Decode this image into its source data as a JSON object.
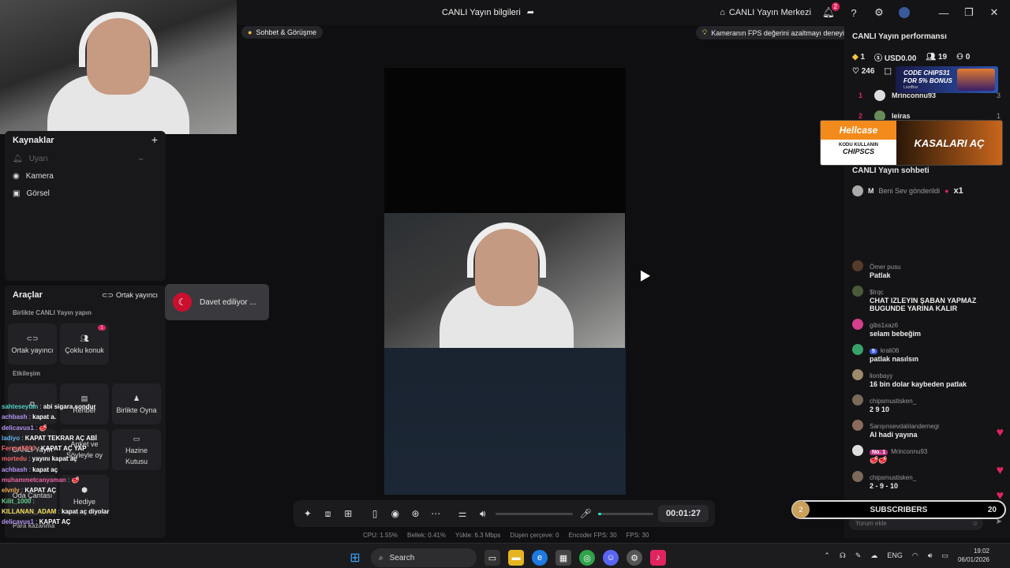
{
  "header": {
    "title": "CANLI Yayın bilgileri",
    "live_center": "CANLI Yayın Merkezi",
    "notif_count": "2"
  },
  "pills": {
    "chat_mode": "Sohbet & Görüşme",
    "fps_tip": "Kameranın FPS değerini azaltmayı deneyin"
  },
  "sources": {
    "title": "Kaynaklar",
    "items": [
      {
        "label": "Uyarı",
        "icon": "bell-icon"
      },
      {
        "label": "Kamera",
        "icon": "camera-icon"
      },
      {
        "label": "Görsel",
        "icon": "image-icon"
      }
    ]
  },
  "tools": {
    "title": "Araçlar",
    "cohost_link": "Ortak yayıncı",
    "section_live": "Birlikte CANLI Yayın yapın",
    "btn_cohost": "Ortak yayıncı",
    "btn_multi": "Çoklu konuk",
    "multi_badge": "1",
    "section_interaction": "Etkileşim",
    "btn_guide": "Rehber",
    "btn_play": "Birlikte Oyna",
    "btn_poll_l1": "Anket ve",
    "btn_poll_l2": "Söyleyle oy",
    "btn_treasure_l1": "Hazine",
    "btn_treasure_l2": "Kutusu",
    "btn_gift": "Hediye",
    "btn_live": "CANLI Yayın",
    "btn_room": "Oda Çantası",
    "monetize": "Para kazanma"
  },
  "invite": {
    "label": "Davet ediliyor ..."
  },
  "overlay_chat": [
    {
      "user": "sahteseytan",
      "text": "abi sigara sondur",
      "color": "#4fd1c5"
    },
    {
      "user": "achbash",
      "text": "kapat a.",
      "color": "#b794f4"
    },
    {
      "user": "delicavus1",
      "text": "🥩",
      "color": "#b794f4"
    },
    {
      "user": "ladiyo",
      "text": "KAPAT TEKRAR AÇ ABİ",
      "color": "#63b3ed"
    },
    {
      "user": "Ferrari5093",
      "text": "KAPAT AÇ YAP",
      "color": "#f56565"
    },
    {
      "user": "mortedu",
      "text": "yayını kapat aç",
      "color": "#f56565"
    },
    {
      "user": "achbash",
      "text": "kapat aç",
      "color": "#b794f4"
    },
    {
      "user": "muhammetcanyaman",
      "text": "🥩",
      "color": "#ed64a6"
    },
    {
      "user": "elvnly",
      "text": "KAPAT AÇ",
      "color": "#f6ad55"
    },
    {
      "user": "Kilit_1000",
      "text": "",
      "color": "#68d391"
    },
    {
      "user": "KILLANAN_ADAM",
      "text": "kapat aç diyolar",
      "color": "#f6e05e"
    },
    {
      "user": "delicavus1",
      "text": "KAPAT AÇ",
      "color": "#b794f4"
    }
  ],
  "controls": {
    "timer": "00:01:27",
    "mic_level": 0.06
  },
  "stats": {
    "cpu": "CPU: 1.55%",
    "memory": "Bellek: 0.41%",
    "upload": "Yükle: 6.3 Mbps",
    "dropped": "Düşen çerçeve: 0",
    "encoder_fps": "Encoder FPS: 30",
    "fps": "FPS: 30"
  },
  "performance": {
    "title": "CANLI Yayın performansı",
    "diamonds": "1",
    "usd": "USD0.00",
    "viewers": "19",
    "new_followers": "0",
    "likes": "246"
  },
  "ranking": [
    {
      "rank": "1",
      "name": "Mrinconnu93",
      "count": "3"
    },
    {
      "rank": "2",
      "name": "leiras",
      "count": "1"
    }
  ],
  "stream_chat": {
    "title": "CANLI Yayın sohbeti",
    "gift_user": "M",
    "gift_text": "Beni Sev gönderildi",
    "gift_count": "x1"
  },
  "chat": [
    {
      "user": "Ömer pusu",
      "text": "Patlak",
      "avatar_color": "#553c2a"
    },
    {
      "user": "$Irqc",
      "text": "CHAT IZLEYIN ŞABAN YAPMAZ BUGUNDE YARINA KALIR",
      "avatar_color": "#4a5a3a"
    },
    {
      "user": "gibs1xaz6",
      "text": "selam bebeğim",
      "avatar_color": "#d53f8c"
    },
    {
      "user": "krali06",
      "text": "patlak nasılsın",
      "avatar_color": "#38a169",
      "badge": "5"
    },
    {
      "user": "lionbayy",
      "text": "16 bin dolar kaybeden patlak",
      "avatar_color": "#9c8a6a"
    },
    {
      "user": "chipsmustisken_",
      "text": "2 9 10",
      "avatar_color": "#7a6a5a"
    },
    {
      "user": "Sarışınsevdalılandernegi",
      "text": "Al hadi yayına",
      "avatar_color": "#8a6a5a"
    },
    {
      "user": "Mrinconnu93",
      "text": "🥩🥩",
      "avatar_color": "#dddddd",
      "badge": "No. 1"
    },
    {
      "user": "chipsmustisken_",
      "text": "2 - 9 - 10",
      "avatar_color": "#7a6a5a"
    }
  ],
  "comment_placeholder": "Yorum ekle",
  "subscribers": {
    "count_left": "2",
    "label": "SUBSCRIBERS",
    "count_right": "20"
  },
  "hellcase": {
    "logo": "Hellcase",
    "code_line1": "KODU KULLANIN",
    "code_line2": "CHIPSCS",
    "cta": "KASALARI AÇ"
  },
  "code_ad": {
    "line1": "CODE CHIPS31",
    "line2": "FOR 5% BONUS",
    "brand": "LootBox"
  },
  "taskbar": {
    "search": "Search",
    "lang": "ENG",
    "time": "19:02",
    "date": "06/01/2026"
  }
}
